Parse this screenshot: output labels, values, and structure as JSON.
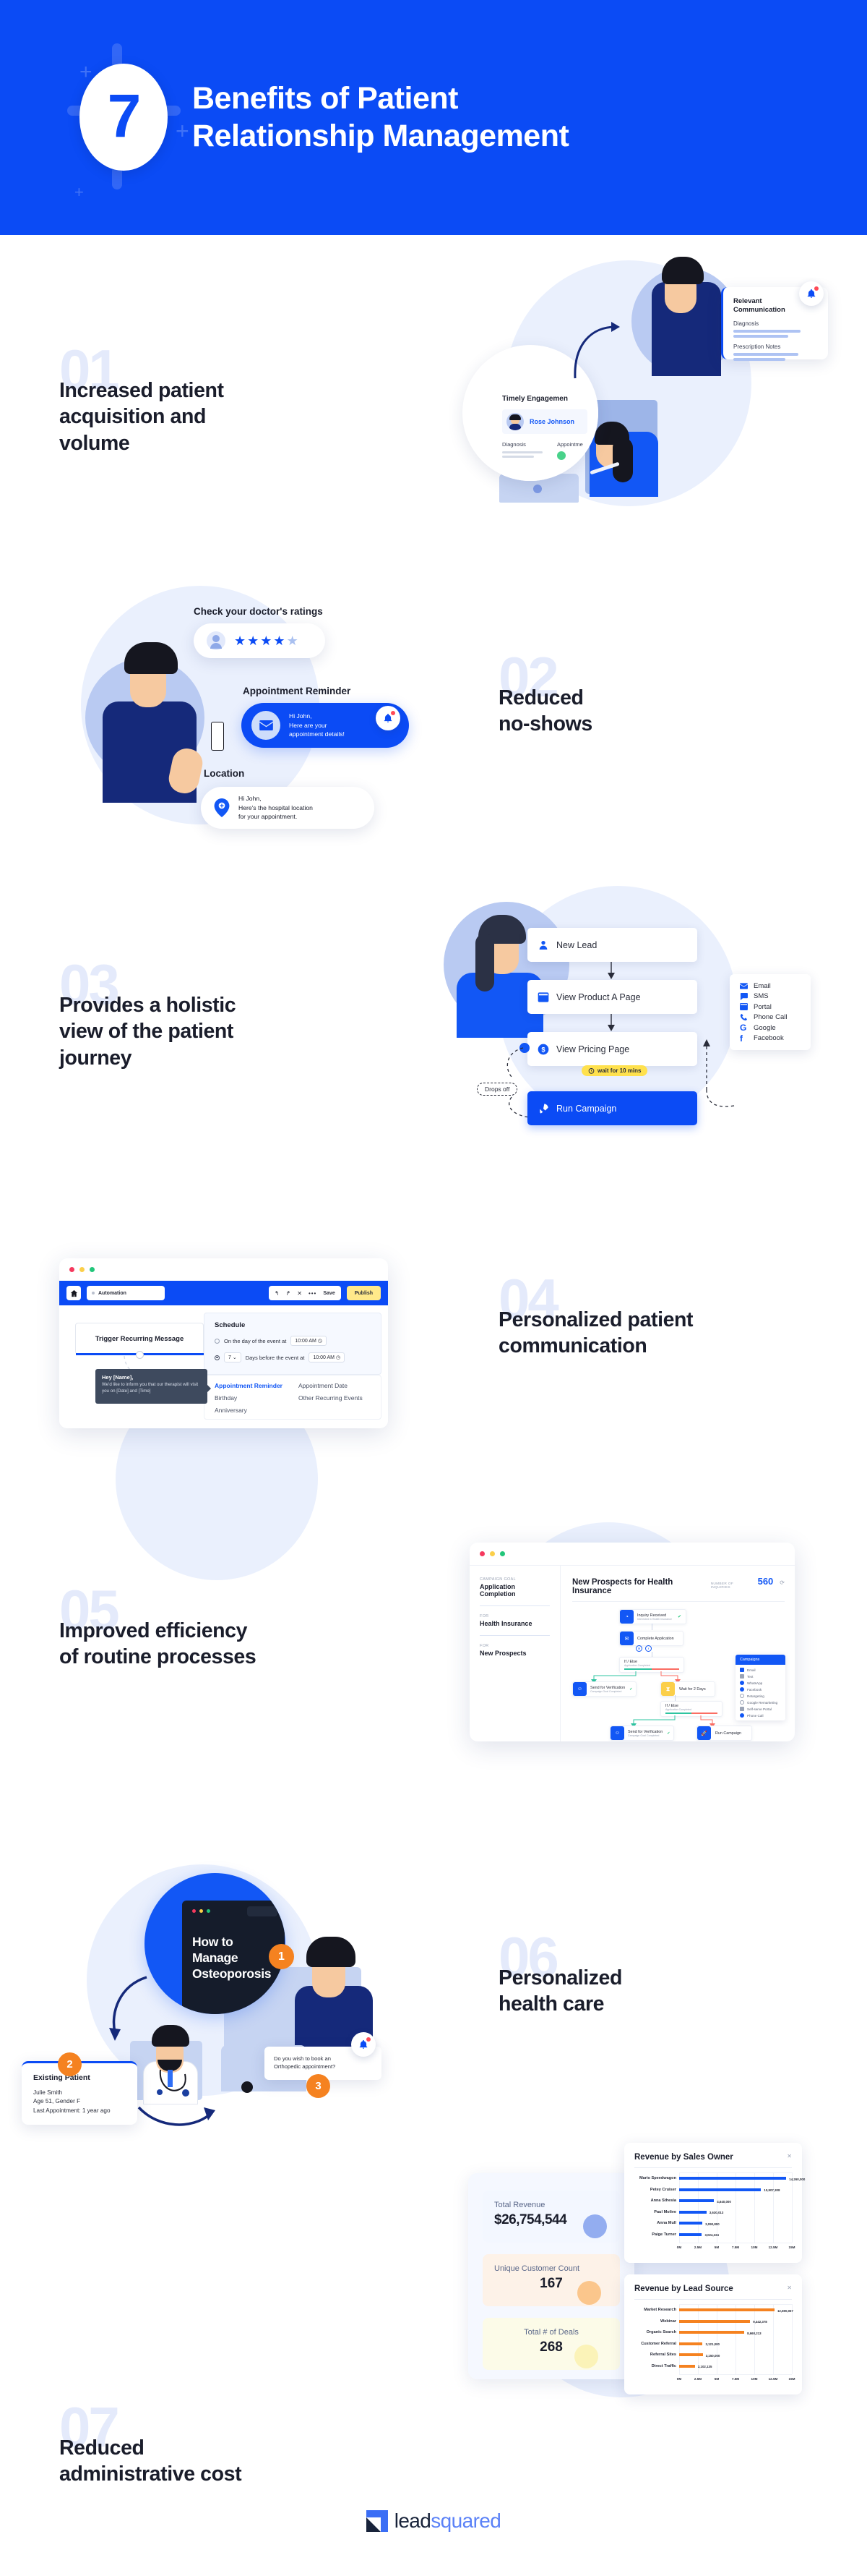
{
  "header": {
    "badge_number": "7",
    "title": "Benefits of Patient\nRelationship Management",
    "bg_color": "#0b4bf5"
  },
  "sections": [
    {
      "number": "01",
      "title": "Increased patient\nacquisition and\nvolume",
      "illustration": {
        "relevant_card": {
          "title": "Relevant\nCommunication",
          "field1": "Diagnosis",
          "field2": "Prescription Notes"
        },
        "timely_card": {
          "title": "Timely Engagemen",
          "patient_name": "Rose Johnson",
          "field1": "Diagnosis",
          "field2": "Appointme"
        }
      }
    },
    {
      "number": "02",
      "title": "Reduced\nno-shows",
      "illustration": {
        "ratings_label": "Check your doctor's ratings",
        "stars_filled": 4,
        "stars_total": 5,
        "reminder_label": "Appointment Reminder",
        "reminder_text": "Hi John,\nHere are your\nappointment details!",
        "location_label": "Location",
        "location_text": "Hi John,\nHere's the hospital location\nfor your appointment."
      }
    },
    {
      "number": "03",
      "title": "Provides a holistic\nview of the patient\njourney",
      "illustration": {
        "steps": [
          {
            "label": "New Lead",
            "icon": "person-icon"
          },
          {
            "label": "View Product A Page",
            "icon": "browser-icon"
          },
          {
            "label": "View Pricing Page",
            "icon": "dollar-icon"
          }
        ],
        "wait_pill": "wait for 10 mins",
        "dropoff_label": "Drops off",
        "run_button": "Run Campaign",
        "channels": [
          {
            "label": "Email",
            "icon": "email-icon"
          },
          {
            "label": "SMS",
            "icon": "sms-icon"
          },
          {
            "label": "Portal",
            "icon": "portal-icon"
          },
          {
            "label": "Phone Call",
            "icon": "phone-icon"
          },
          {
            "label": "Google",
            "icon": "google-icon"
          },
          {
            "label": "Facebook",
            "icon": "facebook-icon"
          }
        ]
      }
    },
    {
      "number": "04",
      "title": "Personalized patient\ncommunication",
      "illustration": {
        "tab_label": "Automation",
        "save_label": "Save",
        "publish_label": "Publish",
        "trigger_label": "Trigger Recurring Message",
        "schedule_label": "Schedule",
        "option1": "On the day of the event at",
        "option1_time": "10:00 AM",
        "option2_days": "7",
        "option2": "Days before the event at",
        "option2_time": "10:00 AM",
        "tooltip_title": "Hey [Name],",
        "tooltip_body": "We'd like to inform you that our therapist will visit you on [Date] and [Time]",
        "events_col1": [
          "Appointment Reminder",
          "Birthday",
          "Anniversary"
        ],
        "events_col2": [
          "Appointment Date",
          "Other Recurring Events"
        ]
      }
    },
    {
      "number": "05",
      "title": "Improved efficiency\nof routine processes",
      "illustration": {
        "sidebar": [
          {
            "caption": "CAMPAIGN GOAL",
            "value": "Application Completion"
          },
          {
            "caption": "FOR",
            "value": "Health Insurance"
          },
          {
            "caption": "FOR",
            "value": "New Prospects"
          }
        ],
        "main_title": "New Prospects for Health Insurance",
        "metric_caption": "NUMBER OF INQUIRIES",
        "metric_value": "560",
        "nodes": [
          {
            "title": "Inquiry Received",
            "sub": "Interested in Health Insurance"
          },
          {
            "title": "Complete Application",
            "sub": ""
          },
          {
            "title": "If / Else",
            "sub": "Application Completed"
          },
          {
            "title": "Send for Verification",
            "sub": "Campaign Goal Completed"
          },
          {
            "title": "Wait for 2 Days",
            "sub": ""
          },
          {
            "title": "If / Else",
            "sub": "Application Completed"
          },
          {
            "title": "Send for Verification",
            "sub": "Campaign Goal Completed"
          },
          {
            "title": "Run Campaign",
            "sub": ""
          }
        ],
        "campaigns_title": "Campaigns",
        "campaigns": [
          "Email",
          "Text",
          "WhatsApp",
          "Facebook",
          "Retargeting",
          "Google Remarketing",
          "Self-serve Portal",
          "Phone Call"
        ]
      }
    },
    {
      "number": "06",
      "title": "Personalized\nhealth care",
      "illustration": {
        "video_title": "How to\nManage\nOsteoporosis",
        "step_badges": [
          "1",
          "2",
          "3"
        ],
        "patient_card_title": "Existing Patient",
        "patient_card_lines": [
          "Julie Smith",
          "Age 51, Gender F",
          "Last Appointment: 1 year ago"
        ],
        "chat_text": "Do you wish to book an\nOrthopedic appointment?"
      }
    },
    {
      "number": "07",
      "title": "Reduced\nadministrative cost",
      "illustration": {
        "kpis": [
          {
            "label": "Total Revenue",
            "value": "$26,754,544",
            "color": "#93adf0",
            "bg": "#f3f7ff"
          },
          {
            "label": "Unique Customer Count",
            "value": "167",
            "color": "#fbc68c",
            "bg": "#fdf2e8"
          },
          {
            "label": "Total # of Deals",
            "value": "268",
            "color": "#fbf3b8",
            "bg": "#fcfbe8"
          }
        ]
      }
    }
  ],
  "chart_data": [
    {
      "type": "bar",
      "orientation": "horizontal",
      "title": "Revenue by Sales Owner",
      "categories": [
        "Mario Speedwagon",
        "Petey Cruiser",
        "Anna Sthesia",
        "Paul Molive",
        "Anna Mull",
        "Paige Turner"
      ],
      "values": [
        14260000,
        10907308,
        4640000,
        3630013,
        3090800,
        3024224
      ],
      "value_labels": [
        "14,260,000",
        "10,907,308",
        "4,640,000",
        "3,630,013",
        "3,090,800",
        "3,024,224"
      ],
      "xticks": [
        "0M",
        "2.5M",
        "5M",
        "7.5M",
        "10M",
        "12.5M",
        "15M"
      ],
      "xlim": [
        0,
        15000000
      ],
      "bar_color": "#1257f5",
      "grid": true,
      "legend": false
    },
    {
      "type": "bar",
      "orientation": "horizontal",
      "title": "Revenue by Lead Source",
      "categories": [
        "Market Research",
        "Webinar",
        "Organic Search",
        "Customer Referral",
        "Referral Sites",
        "Direct Traffic"
      ],
      "values": [
        12690067,
        9442378,
        8660213,
        3121000,
        3150000,
        2102135
      ],
      "value_labels": [
        "12,690,067",
        "9,442,378",
        "8,660,213",
        "3,121,000",
        "3,150,000",
        "2,102,135"
      ],
      "xticks": [
        "0M",
        "2.5M",
        "5M",
        "7.5M",
        "10M",
        "12.5M",
        "15M"
      ],
      "xlim": [
        0,
        15000000
      ],
      "bar_color": "#f58220",
      "grid": true,
      "legend": false
    }
  ],
  "footer": {
    "logo_part1": "lead",
    "logo_part2": "squared"
  }
}
